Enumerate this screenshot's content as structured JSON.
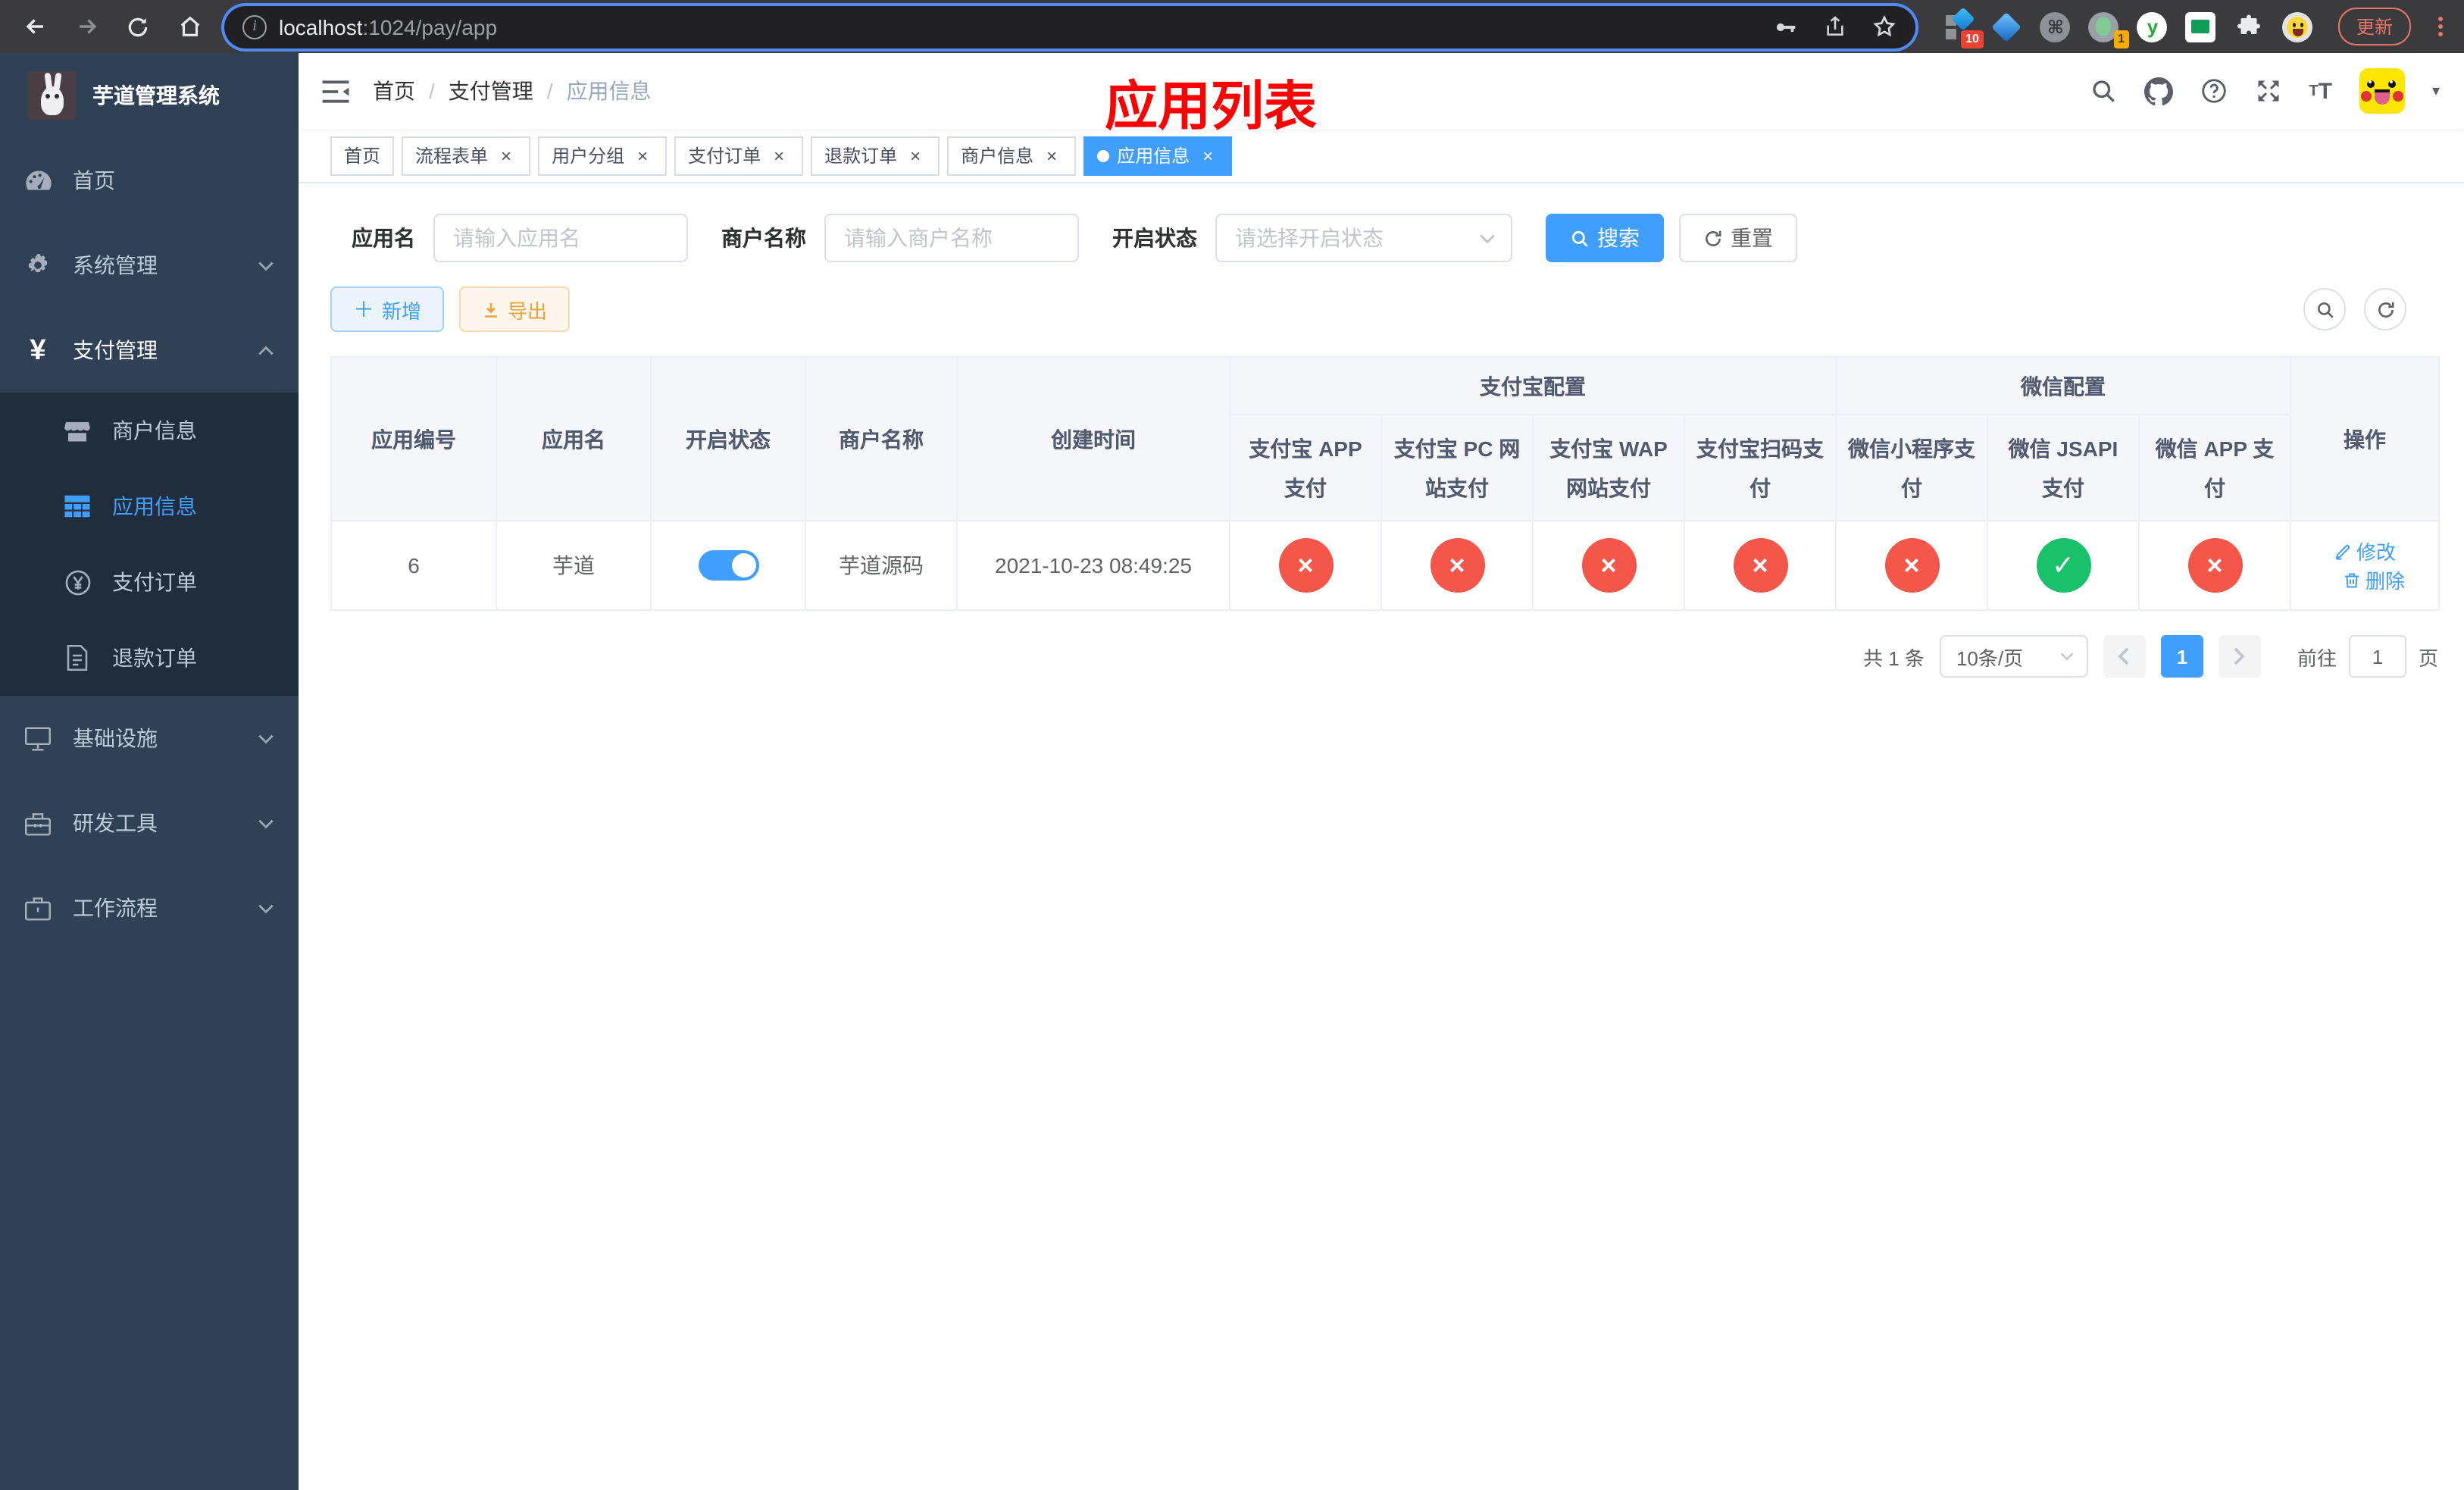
{
  "browser": {
    "url_host": "localhost",
    "url_path": ":1024/pay/app",
    "update_label": "更新",
    "ext_badges": {
      "apps": "10",
      "profile": "1"
    }
  },
  "sidebar": {
    "title": "芋道管理系统",
    "items": [
      {
        "label": "首页"
      },
      {
        "label": "系统管理"
      },
      {
        "label": "支付管理"
      },
      {
        "label": "商户信息"
      },
      {
        "label": "应用信息"
      },
      {
        "label": "支付订单"
      },
      {
        "label": "退款订单"
      },
      {
        "label": "基础设施"
      },
      {
        "label": "研发工具"
      },
      {
        "label": "工作流程"
      }
    ]
  },
  "navbar": {
    "breadcrumb": [
      "首页",
      "支付管理",
      "应用信息"
    ]
  },
  "annotation": {
    "title": "应用列表"
  },
  "tabs": [
    {
      "label": "首页"
    },
    {
      "label": "流程表单"
    },
    {
      "label": "用户分组"
    },
    {
      "label": "支付订单"
    },
    {
      "label": "退款订单"
    },
    {
      "label": "商户信息"
    },
    {
      "label": "应用信息"
    }
  ],
  "filters": {
    "app_name_label": "应用名",
    "app_name_placeholder": "请输入应用名",
    "merchant_label": "商户名称",
    "merchant_placeholder": "请输入商户名称",
    "status_label": "开启状态",
    "status_placeholder": "请选择开启状态",
    "search_label": "搜索",
    "reset_label": "重置"
  },
  "toolbar": {
    "add_label": "新增",
    "export_label": "导出"
  },
  "table": {
    "group_headers": {
      "alipay": "支付宝配置",
      "wechat": "微信配置"
    },
    "columns": {
      "id": "应用编号",
      "name": "应用名",
      "status": "开启状态",
      "merchant": "商户名称",
      "created": "创建时间",
      "alipay_app": "支付宝 APP 支付",
      "alipay_pc": "支付宝 PC 网站支付",
      "alipay_wap": "支付宝 WAP 网站支付",
      "alipay_qr": "支付宝扫码支付",
      "wx_lite": "微信小程序支付",
      "wx_jsapi": "微信 JSAPI 支付",
      "wx_app": "微信 APP 支付",
      "actions": "操作"
    },
    "row": {
      "id": "6",
      "name": "芋道",
      "enabled": true,
      "merchant": "芋道源码",
      "created": "2021-10-23 08:49:25",
      "statuses": [
        false,
        false,
        false,
        false,
        false,
        true,
        false
      ],
      "edit_label": "修改",
      "delete_label": "删除"
    }
  },
  "pagination": {
    "total_label": "共 1 条",
    "page_size": "10条/页",
    "current_page": "1",
    "goto_prefix": "前往",
    "goto_value": "1",
    "goto_suffix": "页"
  },
  "colors": {
    "primary": "#409eff",
    "danger": "#f4564a",
    "success": "#18c16a",
    "annotation": "#ff0000"
  }
}
